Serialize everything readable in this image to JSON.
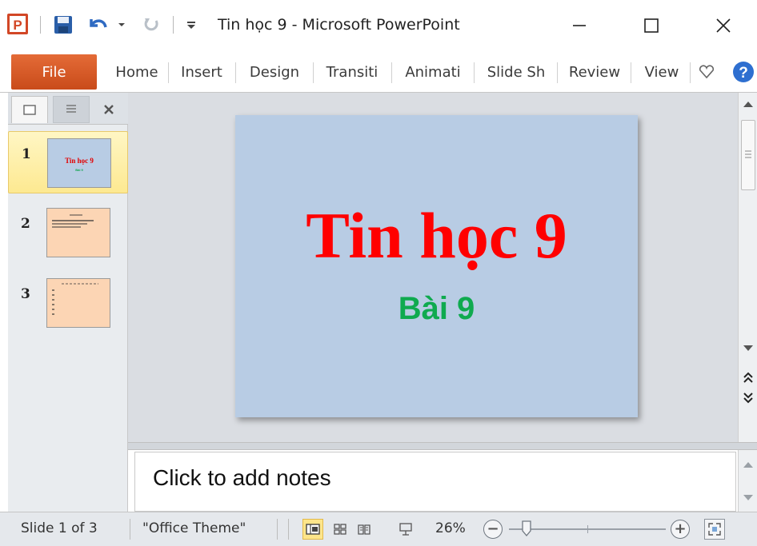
{
  "window": {
    "title": "Tin học 9 - Microsoft PowerPoint",
    "app_icon": "powerpoint-icon",
    "controls": [
      "minimize",
      "maximize",
      "close"
    ]
  },
  "quick_access": [
    "save-icon",
    "undo-icon",
    "undo-dropdown-icon",
    "redo-icon",
    "customize-qat-icon"
  ],
  "ribbon": {
    "file_label": "File",
    "tabs": [
      "Home",
      "Insert",
      "Design",
      "Transiti",
      "Animati",
      "Slide Sh",
      "Review",
      "View"
    ],
    "extra_icons": [
      "minimize-ribbon-icon",
      "help-icon"
    ]
  },
  "slides_panel": {
    "tabs": [
      "slides-tab-icon",
      "outline-tab-icon",
      "close-pane-icon"
    ],
    "thumbnails": [
      {
        "number": "1",
        "title": "Tin học 9",
        "subtitle": "Bài 9",
        "background": "#b8cce4",
        "selected": true
      },
      {
        "number": "2",
        "title": "",
        "subtitle": "",
        "background": "#fcd5b4",
        "selected": false
      },
      {
        "number": "3",
        "title": "",
        "subtitle": "",
        "background": "#fcd5b4",
        "selected": false
      }
    ]
  },
  "slide": {
    "title": "Tin học 9",
    "subtitle": "Bài 9",
    "background": "#b8cce4",
    "title_color": "#ff0000",
    "subtitle_color": "#0faa4f"
  },
  "notes": {
    "placeholder": "Click to add notes"
  },
  "statusbar": {
    "slide_info": "Slide 1 of 3",
    "theme": "\"Office Theme\"",
    "views": [
      "normal-view-icon",
      "slide-sorter-icon",
      "reading-view-icon",
      "slideshow-icon"
    ],
    "zoom": "26%",
    "zoom_level": 0.26,
    "zoom_out_label": "−",
    "zoom_in_label": "+"
  },
  "colors": {
    "file_tab": "#d35a27",
    "panel_bg": "#e9ecef",
    "workspace_bg": "#dadde2"
  }
}
